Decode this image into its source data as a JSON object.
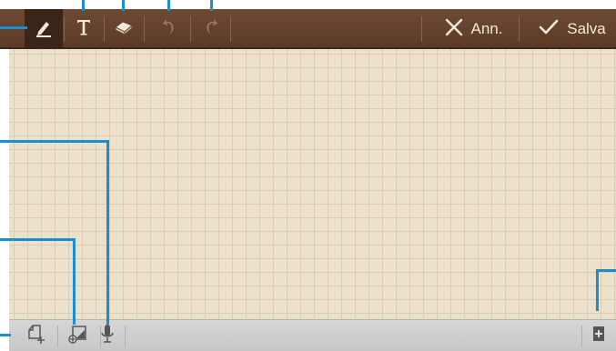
{
  "toolbar": {
    "buttons": [
      {
        "icon": "pen-icon"
      },
      {
        "icon": "text-icon"
      },
      {
        "icon": "eraser-icon"
      },
      {
        "icon": "undo-icon"
      },
      {
        "icon": "redo-icon"
      }
    ],
    "cancel_label": "Ann.",
    "save_label": "Salva"
  },
  "bottombar": {
    "buttons": [
      {
        "icon": "insert-image-icon"
      },
      {
        "icon": "add-page-icon"
      },
      {
        "icon": "microphone-icon"
      },
      {
        "icon": "add-icon"
      }
    ]
  },
  "colors": {
    "toolbar": "#5f3f2b",
    "paper": "#ece2cc",
    "grid": "#d9cdb4",
    "callout": "#1a8fd0"
  }
}
